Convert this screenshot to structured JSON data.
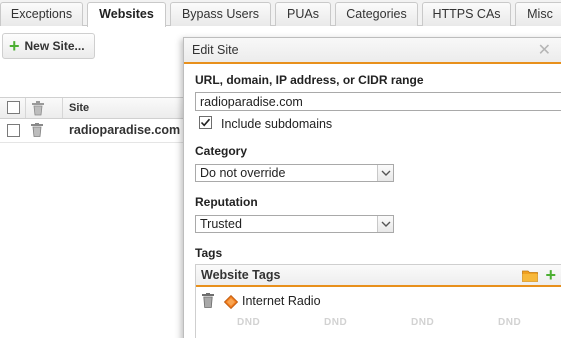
{
  "tabs": [
    {
      "label": "Exceptions",
      "active": false
    },
    {
      "label": "Websites",
      "active": true
    },
    {
      "label": "Bypass Users",
      "active": false
    },
    {
      "label": "PUAs",
      "active": false
    },
    {
      "label": "Categories",
      "active": false
    },
    {
      "label": "HTTPS CAs",
      "active": false
    },
    {
      "label": "Misc",
      "active": false
    }
  ],
  "toolbar": {
    "new_site_label": "New Site..."
  },
  "grid": {
    "columns": {
      "site": "Site"
    },
    "rows": [
      {
        "site": "radioparadise.com",
        "checked": false
      }
    ]
  },
  "dialog": {
    "title": "Edit Site",
    "url_label": "URL, domain, IP address, or CIDR range",
    "url_value": "radioparadise.com",
    "include_subdomains_label": "Include subdomains",
    "include_subdomains_checked": true,
    "category_label": "Category",
    "category_value": "Do not override",
    "reputation_label": "Reputation",
    "reputation_value": "Trusted",
    "tags_label": "Tags",
    "tags_panel": {
      "title": "Website Tags",
      "items": [
        {
          "name": "Internet Radio",
          "icon": "orange-diamond-tag-icon"
        }
      ],
      "dnd_label": "DND"
    }
  },
  "colors": {
    "accent": "#e8901c",
    "add_green": "#4caf32",
    "tag_orange": "#f07c1e"
  }
}
